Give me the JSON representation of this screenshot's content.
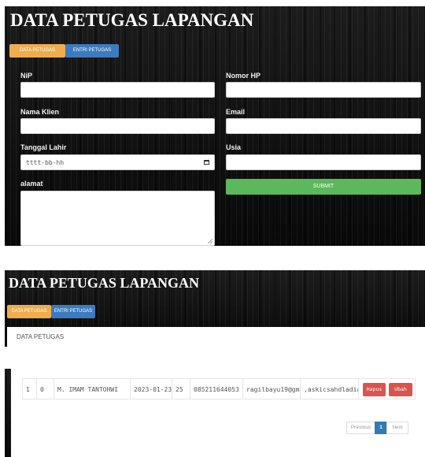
{
  "screen1": {
    "title": "DATA PETUGAS LAPANGAN",
    "tabs": [
      {
        "label": "DATA PETUGAS"
      },
      {
        "label": "ENTRI PETUGAS"
      }
    ],
    "form": {
      "nip_label": "NiP",
      "nomor_hp_label": "Nomor HP",
      "nama_klien_label": "Nama Klien",
      "email_label": "Email",
      "tanggal_lahir_label": "Tanggal Lahir",
      "tanggal_lahir_value": "tttt-bb-hh",
      "usia_label": "Usia",
      "alamat_label": "alamat",
      "submit_label": "SUBMIT"
    }
  },
  "screen2": {
    "title": "DATA PETUGAS LAPANGAN",
    "tabs": [
      {
        "label": "DATA PETUGAS"
      },
      {
        "label": "ENTRI PETUGAS"
      }
    ],
    "panel_heading": "DATA PETUGAS",
    "table_row": {
      "no": "1",
      "nip": "0",
      "nama": "M. IMAM TANTOHWI",
      "tanggal_lahir": "2023-01-23",
      "usia": "25",
      "nomor_hp": "085211644053",
      "email": "ragilbayu19@gma",
      "alamat": ",askicsahdladiay"
    },
    "actions": {
      "hapus": "Hapus",
      "ubah": "Ubah"
    },
    "pagination": {
      "previous": "Previous",
      "current": "1",
      "next": "Next"
    }
  },
  "colors": {
    "tab_active": "#f0ad4e",
    "tab_inactive": "#3b7bbf",
    "submit": "#5cb85c",
    "danger": "#d9534f",
    "page_active": "#337ab7"
  },
  "icons": [
    "calendar-icon",
    "resize-handle-icon"
  ]
}
